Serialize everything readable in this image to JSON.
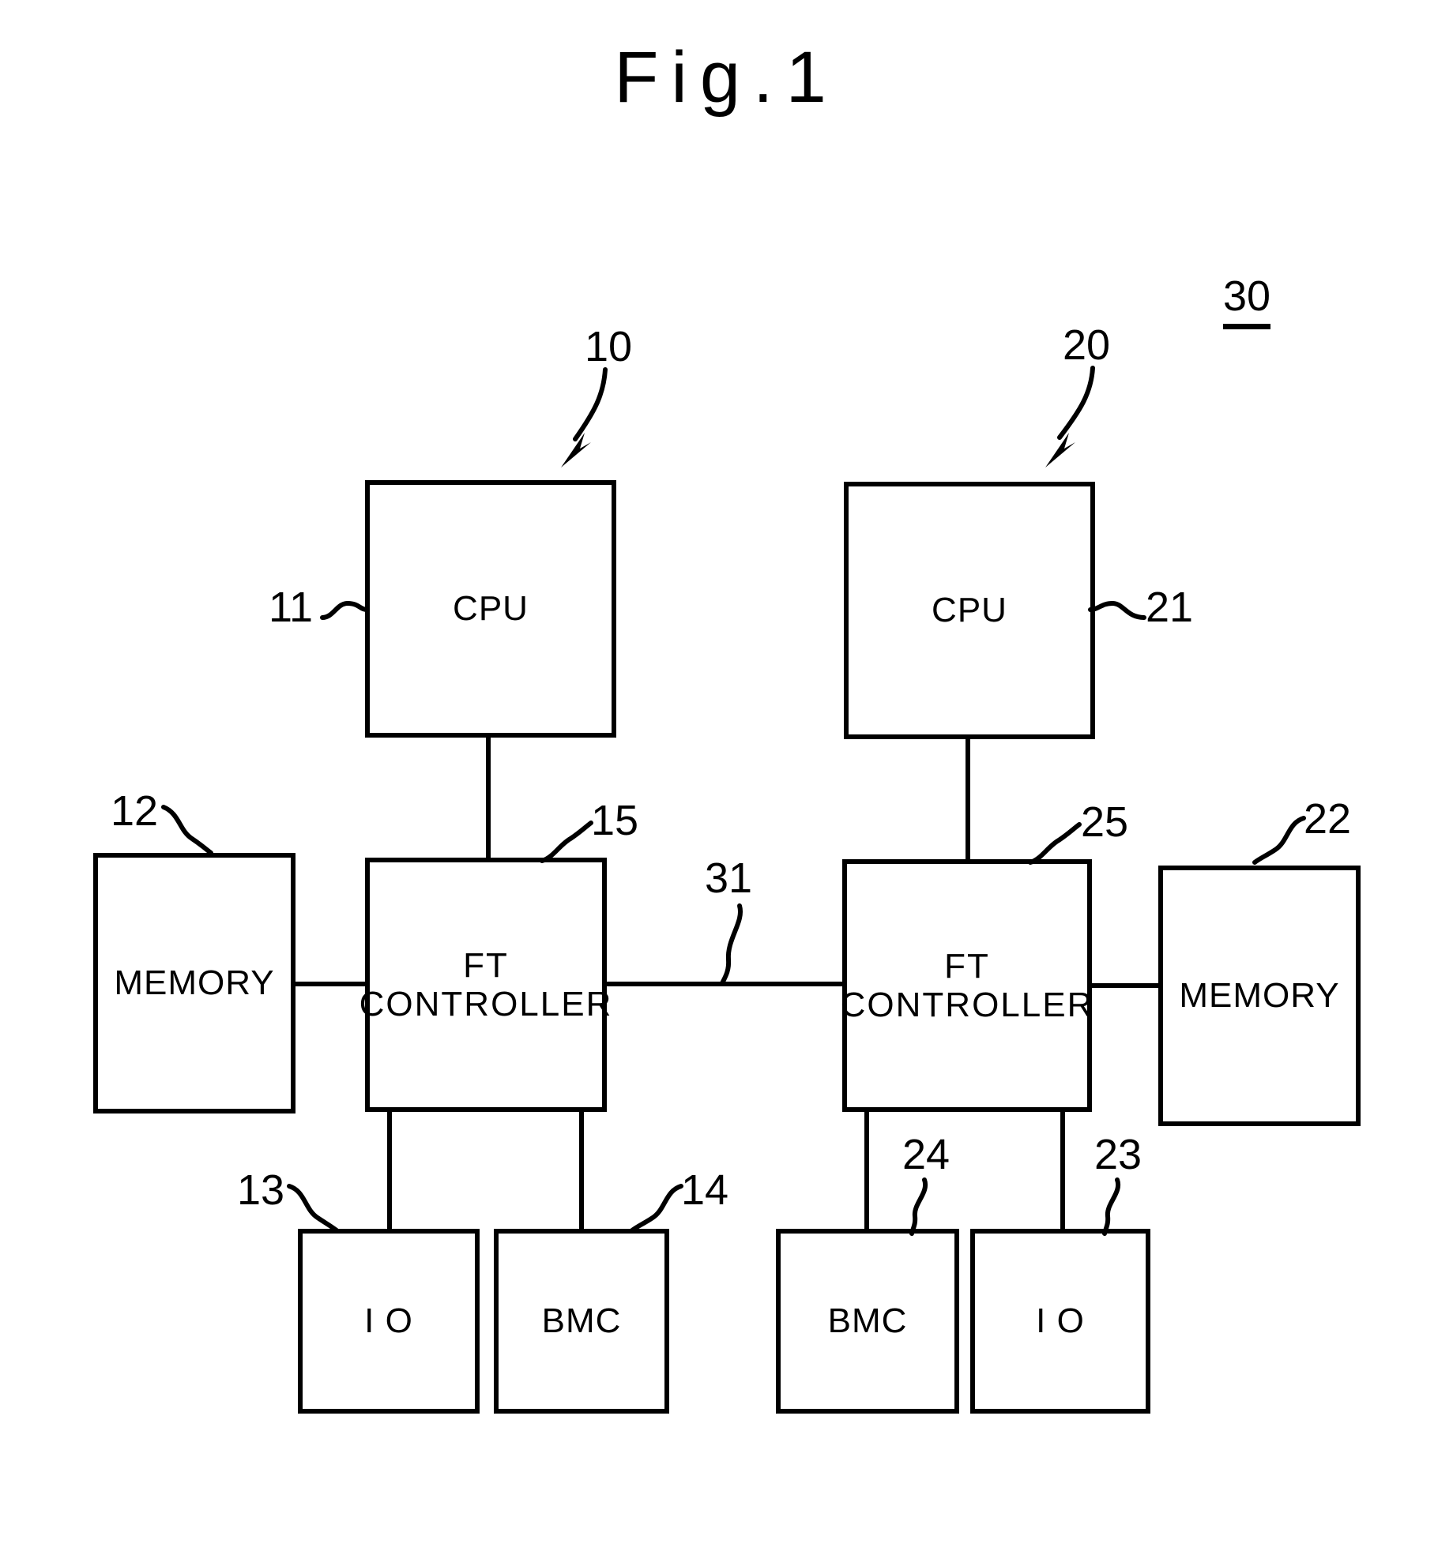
{
  "figure": {
    "title": "Fig.1",
    "system_ref": "30"
  },
  "modules": [
    {
      "id": "cpu-left",
      "label": "CPU",
      "ref": "11"
    },
    {
      "id": "memory-left",
      "label": "MEMORY",
      "ref": "12"
    },
    {
      "id": "ft-controller-left",
      "label": "FT\nCONTROLLER",
      "ref": "15"
    },
    {
      "id": "io-left",
      "label": "I O",
      "ref": "13"
    },
    {
      "id": "bmc-left",
      "label": "BMC",
      "ref": "14"
    },
    {
      "id": "cpu-right",
      "label": "CPU",
      "ref": "21"
    },
    {
      "id": "memory-right",
      "label": "MEMORY",
      "ref": "22"
    },
    {
      "id": "ft-controller-right",
      "label": "FT\nCONTROLLER",
      "ref": "25"
    },
    {
      "id": "bmc-right",
      "label": "BMC",
      "ref": "24"
    },
    {
      "id": "io-right",
      "label": "I O",
      "ref": "23"
    }
  ],
  "groups": {
    "left_node_ref": "10",
    "right_node_ref": "20",
    "interconnect_ref": "31"
  }
}
